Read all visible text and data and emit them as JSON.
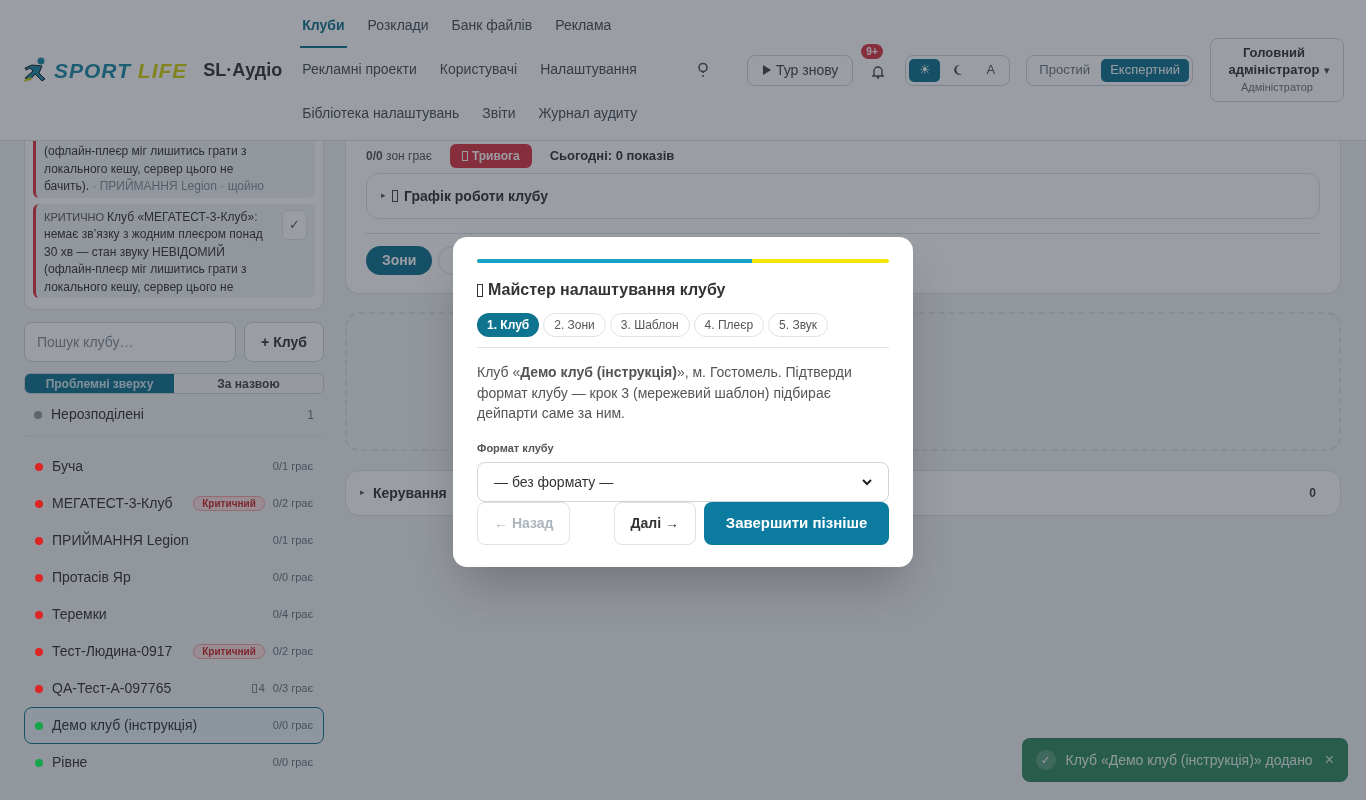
{
  "header": {
    "logo": {
      "word_1": "SPORT",
      "word_2": "LIFE"
    },
    "app_name": "SL·Аудіо",
    "nav_rows": [
      [
        {
          "label": "Клуби",
          "selected": true
        },
        {
          "label": "Розклади",
          "selected": false
        },
        {
          "label": "Банк файлів",
          "selected": false
        },
        {
          "label": "Реклама",
          "selected": false
        }
      ],
      [
        {
          "label": "Рекламні проекти",
          "selected": false
        },
        {
          "label": "Користувачі",
          "selected": false
        },
        {
          "label": "Налаштування",
          "selected": false
        }
      ],
      [
        {
          "label": "Бібліотека налаштувань",
          "selected": false
        },
        {
          "label": "Звіти",
          "selected": false
        },
        {
          "label": "Журнал аудиту",
          "selected": false
        }
      ]
    ],
    "tour_button": "Тур знову",
    "notifications_badge": "9+",
    "theme_options": [
      {
        "kind": "sun",
        "label": "☀",
        "selected": true
      },
      {
        "kind": "moon",
        "selected": false
      },
      {
        "kind": "auto",
        "label": "A",
        "selected": false
      }
    ],
    "mode_options": [
      {
        "label": "Простий",
        "selected": false
      },
      {
        "label": "Експертний",
        "selected": true
      }
    ],
    "user": {
      "name": "Головний адміністратор",
      "caret": "▾",
      "role": "Адміністратор"
    }
  },
  "alerts": [
    {
      "text": "(офлайн-плеєр міг лишитись грати з локального кешу, сервер цього не бачить).",
      "meta": "· ПРИЙМАННЯ Legion · щойно"
    },
    {
      "label": "КРИТИЧНО",
      "text": "Клуб «МЕГАТЕСТ-3-Клуб»: немає зв’язку з жодним плеєром понад 30 хв — стан звуку НЕВІДОМИЙ (офлайн-плеєр міг лишитись грати з локального кешу, сервер цього не",
      "action": "✓"
    }
  ],
  "search": {
    "placeholder": "Пошук клубу…"
  },
  "add_button": "+ Клуб",
  "sort_options": [
    {
      "label": "Проблемні зверху",
      "selected": true
    },
    {
      "label": "За назвою",
      "selected": false
    }
  ],
  "unassigned": {
    "name": "Нерозподілені",
    "count": "1",
    "color": "#5f656d"
  },
  "clubs": [
    {
      "name": "Буча",
      "color": "#dc2626",
      "stat": "0/1 грає",
      "selected": false
    },
    {
      "name": "МЕГАТЕСТ-3-Клуб",
      "color": "#dc2626",
      "badge": "Критичний",
      "stat": "0/2 грає",
      "selected": false
    },
    {
      "name": "ПРИЙМАННЯ Legion",
      "color": "#dc2626",
      "stat": "0/1 грає",
      "selected": false
    },
    {
      "name": "Протасів Яр",
      "color": "#dc2626",
      "stat": "0/0 грає",
      "selected": false
    },
    {
      "name": "Теремки",
      "color": "#dc2626",
      "stat": "0/4 грає",
      "selected": false
    },
    {
      "name": "Тест-Людина-0917",
      "color": "#dc2626",
      "badge": "Критичний",
      "stat": "0/2 грає",
      "selected": false
    },
    {
      "name": "QA-Тест-А-097765",
      "color": "#dc2626",
      "extra": "4",
      "stat": "0/3 грає",
      "selected": false
    },
    {
      "name": "Демо клуб (інструкція)",
      "color": "#16a34a",
      "stat": "0/0 грає",
      "selected": true
    },
    {
      "name": "Рівне",
      "color": "#16a34a",
      "stat": "0/0 грає",
      "selected": false
    }
  ],
  "club_panel": {
    "zones_playing": "**0/0** зон грає",
    "alarm": "Тривога",
    "today": "Сьогодні: 0 показів",
    "schedule": {
      "caret": "▸",
      "title": "Графік роботи клубу"
    },
    "tabs": [
      {
        "label": "Зони",
        "selected": true
      }
    ],
    "management": {
      "caret": "▸",
      "title": "Керування",
      "count": "0"
    }
  },
  "wizard": {
    "level": 0.667,
    "title": "Майстер налаштування клубу",
    "steps": [
      {
        "label": "1. Клуб",
        "selected": true
      },
      {
        "label": "2. Зони",
        "selected": false
      },
      {
        "label": "3. Шаблон",
        "selected": false
      },
      {
        "label": "4. Плеєр",
        "selected": false
      },
      {
        "label": "5. Звук",
        "selected": false
      }
    ],
    "body": "Клуб «**Демо клуб (інструкція)**», м. Гостомель. Підтверди формат клубу — крок 3 (мережевий шаблон) підбирає дейпарти саме за ним.",
    "field_label": "Формат клубу",
    "select_value": "— без формату —",
    "back_button": {
      "label": "← Назад",
      "disabled": true
    },
    "next_button": {
      "label": "Далі →",
      "disabled": false
    },
    "finish_button": "Завершити пізніше"
  },
  "toast": {
    "icon": "✓",
    "text": "Клуб «Демо клуб (інструкція)» додано",
    "close": "×"
  }
}
